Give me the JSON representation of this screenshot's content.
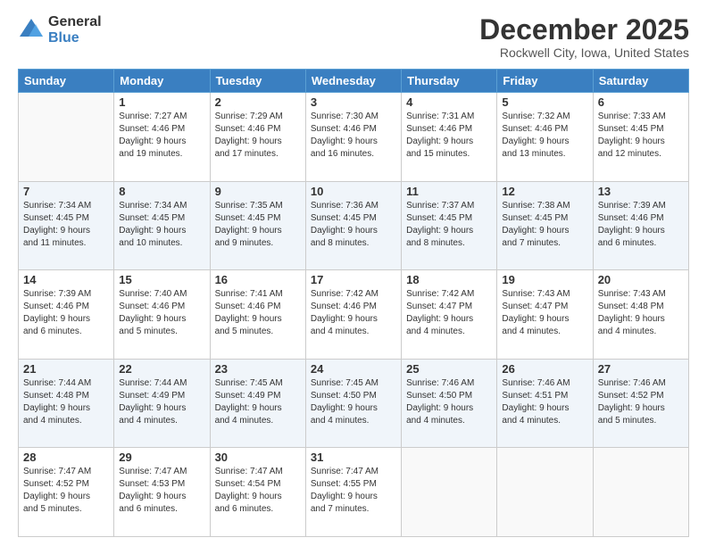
{
  "logo": {
    "general": "General",
    "blue": "Blue"
  },
  "header": {
    "month": "December 2025",
    "location": "Rockwell City, Iowa, United States"
  },
  "weekdays": [
    "Sunday",
    "Monday",
    "Tuesday",
    "Wednesday",
    "Thursday",
    "Friday",
    "Saturday"
  ],
  "weeks": [
    [
      {
        "day": "",
        "info": ""
      },
      {
        "day": "1",
        "info": "Sunrise: 7:27 AM\nSunset: 4:46 PM\nDaylight: 9 hours\nand 19 minutes."
      },
      {
        "day": "2",
        "info": "Sunrise: 7:29 AM\nSunset: 4:46 PM\nDaylight: 9 hours\nand 17 minutes."
      },
      {
        "day": "3",
        "info": "Sunrise: 7:30 AM\nSunset: 4:46 PM\nDaylight: 9 hours\nand 16 minutes."
      },
      {
        "day": "4",
        "info": "Sunrise: 7:31 AM\nSunset: 4:46 PM\nDaylight: 9 hours\nand 15 minutes."
      },
      {
        "day": "5",
        "info": "Sunrise: 7:32 AM\nSunset: 4:46 PM\nDaylight: 9 hours\nand 13 minutes."
      },
      {
        "day": "6",
        "info": "Sunrise: 7:33 AM\nSunset: 4:45 PM\nDaylight: 9 hours\nand 12 minutes."
      }
    ],
    [
      {
        "day": "7",
        "info": "Sunrise: 7:34 AM\nSunset: 4:45 PM\nDaylight: 9 hours\nand 11 minutes."
      },
      {
        "day": "8",
        "info": "Sunrise: 7:34 AM\nSunset: 4:45 PM\nDaylight: 9 hours\nand 10 minutes."
      },
      {
        "day": "9",
        "info": "Sunrise: 7:35 AM\nSunset: 4:45 PM\nDaylight: 9 hours\nand 9 minutes."
      },
      {
        "day": "10",
        "info": "Sunrise: 7:36 AM\nSunset: 4:45 PM\nDaylight: 9 hours\nand 8 minutes."
      },
      {
        "day": "11",
        "info": "Sunrise: 7:37 AM\nSunset: 4:45 PM\nDaylight: 9 hours\nand 8 minutes."
      },
      {
        "day": "12",
        "info": "Sunrise: 7:38 AM\nSunset: 4:45 PM\nDaylight: 9 hours\nand 7 minutes."
      },
      {
        "day": "13",
        "info": "Sunrise: 7:39 AM\nSunset: 4:46 PM\nDaylight: 9 hours\nand 6 minutes."
      }
    ],
    [
      {
        "day": "14",
        "info": "Sunrise: 7:39 AM\nSunset: 4:46 PM\nDaylight: 9 hours\nand 6 minutes."
      },
      {
        "day": "15",
        "info": "Sunrise: 7:40 AM\nSunset: 4:46 PM\nDaylight: 9 hours\nand 5 minutes."
      },
      {
        "day": "16",
        "info": "Sunrise: 7:41 AM\nSunset: 4:46 PM\nDaylight: 9 hours\nand 5 minutes."
      },
      {
        "day": "17",
        "info": "Sunrise: 7:42 AM\nSunset: 4:46 PM\nDaylight: 9 hours\nand 4 minutes."
      },
      {
        "day": "18",
        "info": "Sunrise: 7:42 AM\nSunset: 4:47 PM\nDaylight: 9 hours\nand 4 minutes."
      },
      {
        "day": "19",
        "info": "Sunrise: 7:43 AM\nSunset: 4:47 PM\nDaylight: 9 hours\nand 4 minutes."
      },
      {
        "day": "20",
        "info": "Sunrise: 7:43 AM\nSunset: 4:48 PM\nDaylight: 9 hours\nand 4 minutes."
      }
    ],
    [
      {
        "day": "21",
        "info": "Sunrise: 7:44 AM\nSunset: 4:48 PM\nDaylight: 9 hours\nand 4 minutes."
      },
      {
        "day": "22",
        "info": "Sunrise: 7:44 AM\nSunset: 4:49 PM\nDaylight: 9 hours\nand 4 minutes."
      },
      {
        "day": "23",
        "info": "Sunrise: 7:45 AM\nSunset: 4:49 PM\nDaylight: 9 hours\nand 4 minutes."
      },
      {
        "day": "24",
        "info": "Sunrise: 7:45 AM\nSunset: 4:50 PM\nDaylight: 9 hours\nand 4 minutes."
      },
      {
        "day": "25",
        "info": "Sunrise: 7:46 AM\nSunset: 4:50 PM\nDaylight: 9 hours\nand 4 minutes."
      },
      {
        "day": "26",
        "info": "Sunrise: 7:46 AM\nSunset: 4:51 PM\nDaylight: 9 hours\nand 4 minutes."
      },
      {
        "day": "27",
        "info": "Sunrise: 7:46 AM\nSunset: 4:52 PM\nDaylight: 9 hours\nand 5 minutes."
      }
    ],
    [
      {
        "day": "28",
        "info": "Sunrise: 7:47 AM\nSunset: 4:52 PM\nDaylight: 9 hours\nand 5 minutes."
      },
      {
        "day": "29",
        "info": "Sunrise: 7:47 AM\nSunset: 4:53 PM\nDaylight: 9 hours\nand 6 minutes."
      },
      {
        "day": "30",
        "info": "Sunrise: 7:47 AM\nSunset: 4:54 PM\nDaylight: 9 hours\nand 6 minutes."
      },
      {
        "day": "31",
        "info": "Sunrise: 7:47 AM\nSunset: 4:55 PM\nDaylight: 9 hours\nand 7 minutes."
      },
      {
        "day": "",
        "info": ""
      },
      {
        "day": "",
        "info": ""
      },
      {
        "day": "",
        "info": ""
      }
    ]
  ]
}
